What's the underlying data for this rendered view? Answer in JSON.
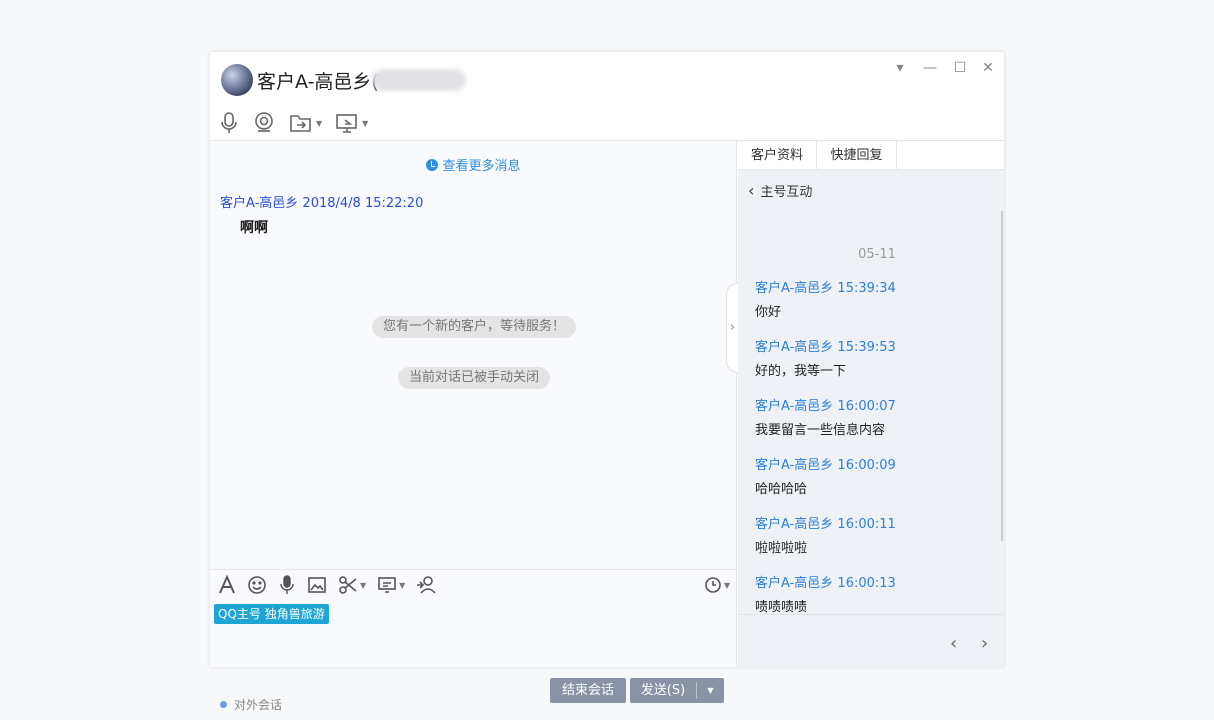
{
  "header": {
    "title": "客户A-高邑乡(",
    "window_controls": [
      "▾",
      "—",
      "☐",
      "✕"
    ],
    "toolbar_icons": [
      "mic-icon",
      "camera-icon",
      "folder-transfer-icon",
      "screen-share-icon"
    ]
  },
  "chat": {
    "more_messages": "查看更多消息",
    "message": {
      "sender_time": "客户A-高邑乡  2018/4/8 15:22:20",
      "text": "啊啊"
    },
    "system_notices": [
      "您有一个新的客户，等待服务！",
      "当前对话已被手动关闭"
    ],
    "input_toolbar_icons": [
      "font-icon",
      "emoji-icon",
      "mic-icon",
      "image-icon",
      "scissors-icon",
      "screen-icon",
      "transfer-user-icon",
      "history-clock-icon"
    ],
    "tag": "QQ主号 独角兽旅游",
    "external_label": "对外会话",
    "end_button": "结束会话",
    "send_button": "发送(S)"
  },
  "right_panel": {
    "tabs": [
      "客户资料",
      "快捷回复"
    ],
    "back_label": "主号互动",
    "date_separator": "05-11",
    "messages": [
      {
        "sender": "客户A-高邑乡 15:39:34",
        "text": "你好"
      },
      {
        "sender": "客户A-高邑乡 15:39:53",
        "text": "好的，我等一下"
      },
      {
        "sender": "客户A-高邑乡 16:00:07",
        "text": "我要留言一些信息内容"
      },
      {
        "sender": "客户A-高邑乡 16:00:09",
        "text": "哈哈哈哈"
      },
      {
        "sender": "客户A-高邑乡 16:00:11",
        "text": "啦啦啦啦"
      },
      {
        "sender": "客户A-高邑乡 16:00:13",
        "text": "啧啧啧啧"
      }
    ],
    "pager": [
      "‹",
      "›"
    ]
  }
}
